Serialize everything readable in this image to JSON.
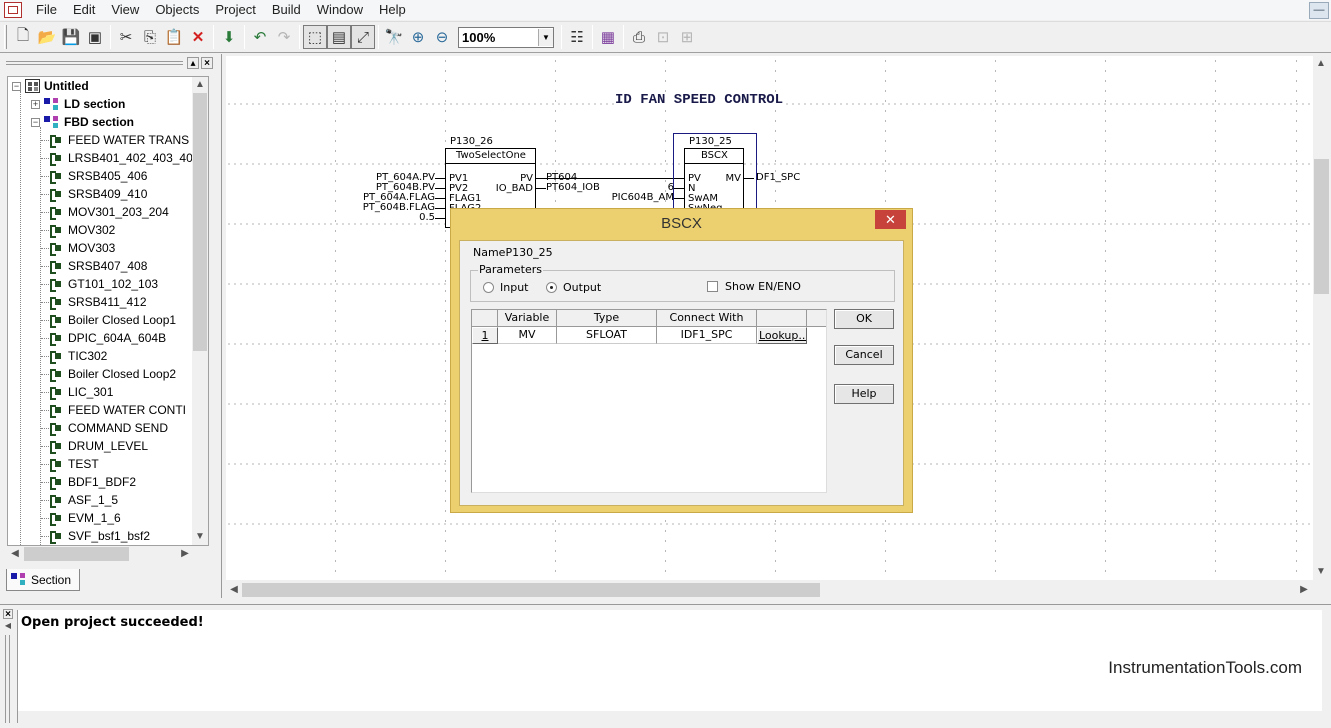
{
  "menubar": {
    "items": [
      "File",
      "Edit",
      "View",
      "Objects",
      "Project",
      "Build",
      "Window",
      "Help"
    ],
    "minimize_icon": "minimize-icon"
  },
  "toolbar": {
    "buttons": [
      {
        "name": "new-icon",
        "glyph": "🗋"
      },
      {
        "name": "open-icon",
        "glyph": "📂"
      },
      {
        "name": "save-icon",
        "glyph": "💾"
      },
      {
        "name": "save-all-icon",
        "glyph": "▣"
      },
      {
        "name": "cut-icon",
        "glyph": "✂"
      },
      {
        "name": "copy-icon",
        "glyph": "⎘"
      },
      {
        "name": "paste-icon",
        "glyph": "📋"
      },
      {
        "name": "delete-icon",
        "glyph": "✕"
      },
      {
        "name": "download-icon",
        "glyph": "⬇"
      },
      {
        "name": "undo-icon",
        "glyph": "↶"
      },
      {
        "name": "redo-icon",
        "glyph": "↷"
      },
      {
        "name": "select-icon",
        "glyph": "⬚"
      },
      {
        "name": "layout-icon",
        "glyph": "▤"
      },
      {
        "name": "zoom-fit-icon",
        "glyph": "⤢"
      },
      {
        "name": "find-icon",
        "glyph": "🔭"
      },
      {
        "name": "zoom-in-icon",
        "glyph": "⊕"
      },
      {
        "name": "zoom-out-icon",
        "glyph": "⊖"
      }
    ],
    "zoom_value": "100%",
    "buttons_after": [
      {
        "name": "properties-icon",
        "glyph": "☷"
      },
      {
        "name": "calendar-icon",
        "glyph": "▦"
      },
      {
        "name": "connect-icon",
        "glyph": "⎙"
      },
      {
        "name": "monitor-icon",
        "glyph": "⊡"
      },
      {
        "name": "chart-icon",
        "glyph": "⊞"
      }
    ]
  },
  "tree": {
    "root": "Untitled",
    "sections": [
      {
        "label": "LD section",
        "expanded": false
      },
      {
        "label": "FBD section",
        "expanded": true
      }
    ],
    "items": [
      "FEED WATER TRANS",
      "LRSB401_402_403_40",
      "SRSB405_406",
      "SRSB409_410",
      "MOV301_203_204",
      "MOV302",
      "MOV303",
      "SRSB407_408",
      "GT101_102_103",
      "SRSB411_412",
      "Boiler Closed Loop1",
      "DPIC_604A_604B",
      "TIC302",
      "Boiler Closed Loop2",
      "LIC_301",
      "FEED WATER CONTI",
      "COMMAND SEND",
      "DRUM_LEVEL",
      "TEST",
      "BDF1_BDF2",
      "ASF_1_5",
      "EVM_1_6",
      "SVF_bsf1_bsf2"
    ],
    "tab_label": "Section"
  },
  "canvas": {
    "title": "ID FAN SPEED CONTROL",
    "block1": {
      "id": "P130_26",
      "type": "TwoSelectOne",
      "inputs": [
        "PV1",
        "PV2",
        "FLAG1",
        "FLAG2"
      ],
      "input_wires": [
        "PT_604A.PV",
        "PT_604B.PV",
        "PT_604A.FLAG",
        "PT_604B.FLAG",
        "0.5"
      ],
      "outputs": [
        "PV",
        "IO_BAD"
      ],
      "output_wires": [
        "PT604",
        "PT604_IOB"
      ]
    },
    "block2": {
      "id": "P130_25",
      "type": "BSCX",
      "inputs": [
        "PV",
        "N",
        "SwAM",
        "SwNeg"
      ],
      "input_wires": [
        "6",
        "PIC604B_AM"
      ],
      "outputs": [
        "MV"
      ],
      "output_wires": [
        "DF1_SPC"
      ]
    }
  },
  "output": {
    "message": "Open project succeeded!",
    "watermark": "InstrumentationTools.com"
  },
  "dialog": {
    "title": "BSCX",
    "name_label": "Name",
    "name_value": "P130_25",
    "parameters_label": "Parameters",
    "radio_input": "Input",
    "radio_output": "Output",
    "selected_radio": "Output",
    "show_en_eno": "Show EN/ENO",
    "show_en_eno_checked": false,
    "columns": [
      "Variable",
      "Type",
      "Connect With",
      ""
    ],
    "rows": [
      {
        "num": "1",
        "variable": "MV",
        "type": "SFLOAT",
        "connect_with": "IDF1_SPC",
        "action": "Lookup..."
      }
    ],
    "ok": "OK",
    "cancel": "Cancel",
    "help": "Help",
    "accent_color": "#ecd06f",
    "close_color": "#c7423a"
  }
}
